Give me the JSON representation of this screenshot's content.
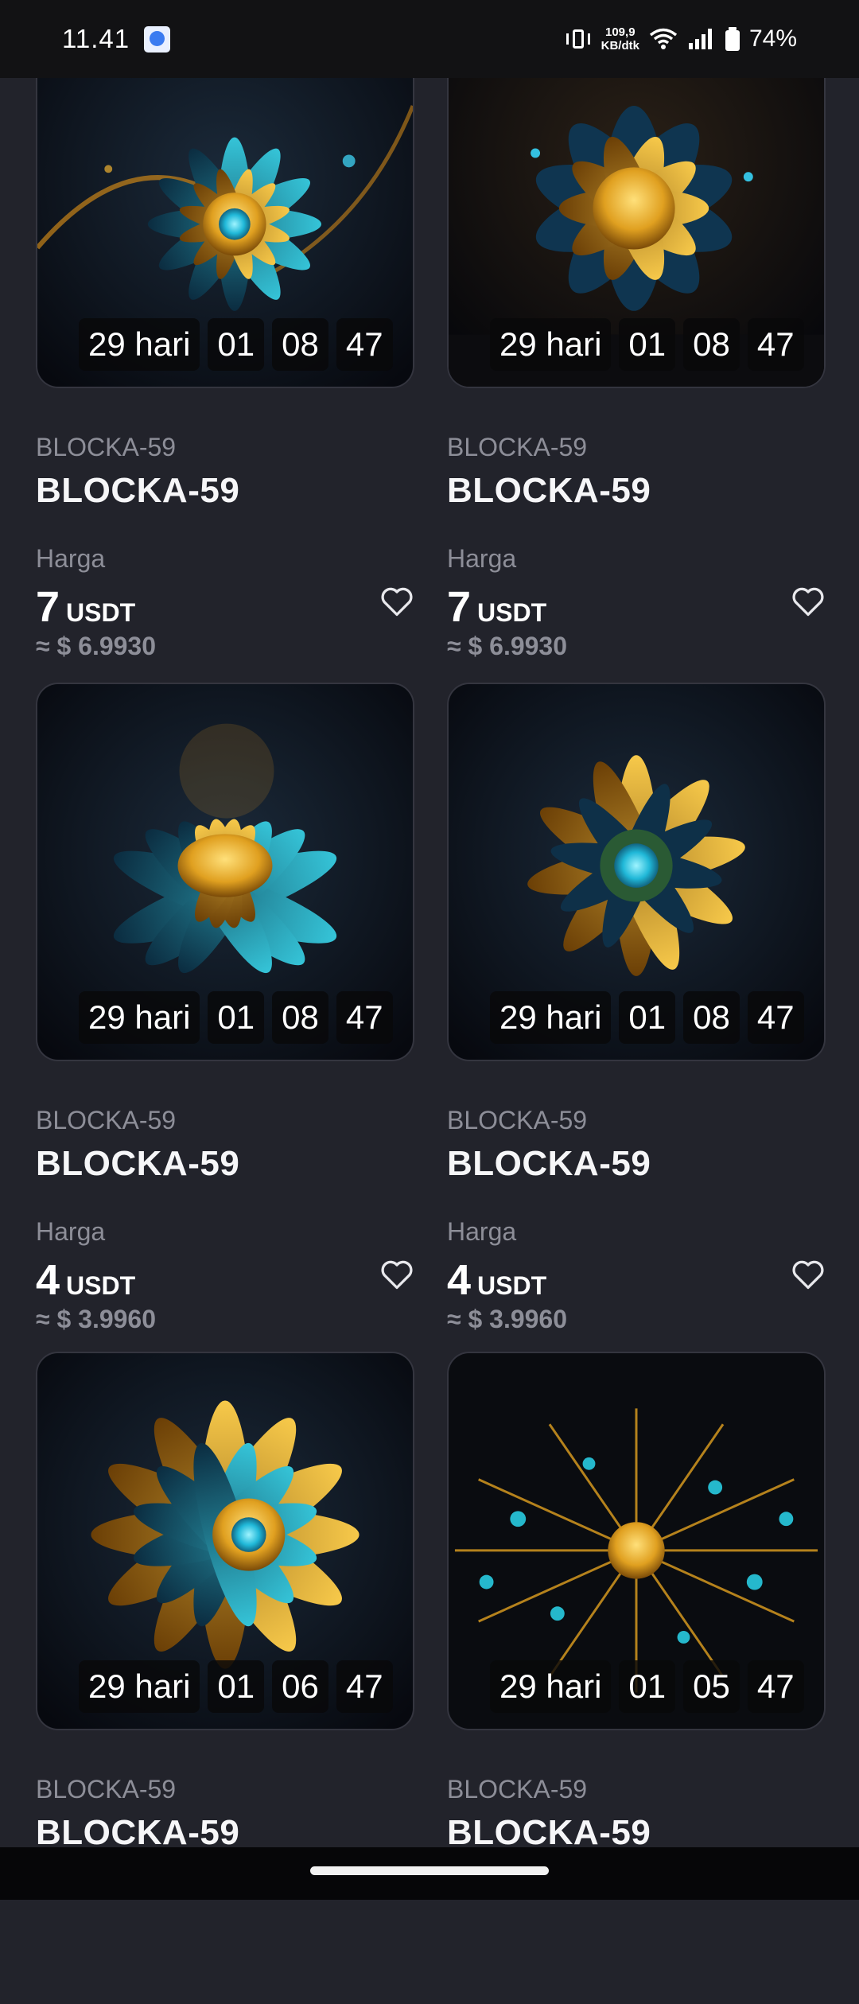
{
  "status_bar": {
    "time": "11.41",
    "net_speed_value": "109,9",
    "net_speed_unit": "KB/dtk",
    "battery": "74%",
    "icons": [
      "app-icon",
      "vibrate-icon",
      "wifi-icon",
      "signal-icon",
      "battery-icon"
    ]
  },
  "products": [
    {
      "subtitle": "BLOCKA-59",
      "title": "BLOCKA-59",
      "price_label": "Harga",
      "price": "7",
      "currency": "USDT",
      "approx": "≈ $ 6.9930",
      "countdown": {
        "days": "29 hari",
        "hours": "01",
        "minutes": "08",
        "seconds": "47"
      }
    },
    {
      "subtitle": "BLOCKA-59",
      "title": "BLOCKA-59",
      "price_label": "Harga",
      "price": "7",
      "currency": "USDT",
      "approx": "≈ $ 6.9930",
      "countdown": {
        "days": "29 hari",
        "hours": "01",
        "minutes": "08",
        "seconds": "47"
      }
    },
    {
      "subtitle": "BLOCKA-59",
      "title": "BLOCKA-59",
      "price_label": "Harga",
      "price": "4",
      "currency": "USDT",
      "approx": "≈ $ 3.9960",
      "countdown": {
        "days": "29 hari",
        "hours": "01",
        "minutes": "08",
        "seconds": "47"
      }
    },
    {
      "subtitle": "BLOCKA-59",
      "title": "BLOCKA-59",
      "price_label": "Harga",
      "price": "4",
      "currency": "USDT",
      "approx": "≈ $ 3.9960",
      "countdown": {
        "days": "29 hari",
        "hours": "01",
        "minutes": "08",
        "seconds": "47"
      }
    },
    {
      "subtitle": "BLOCKA-59",
      "title": "BLOCKA-59",
      "countdown": {
        "days": "29 hari",
        "hours": "01",
        "minutes": "06",
        "seconds": "47"
      }
    },
    {
      "subtitle": "BLOCKA-59",
      "title": "BLOCKA-59",
      "countdown": {
        "days": "29 hari",
        "hours": "01",
        "minutes": "05",
        "seconds": "47"
      }
    }
  ],
  "colors": {
    "background": "#22232b",
    "accent_gold": "#e0a020",
    "accent_cyan": "#20b8d8"
  }
}
